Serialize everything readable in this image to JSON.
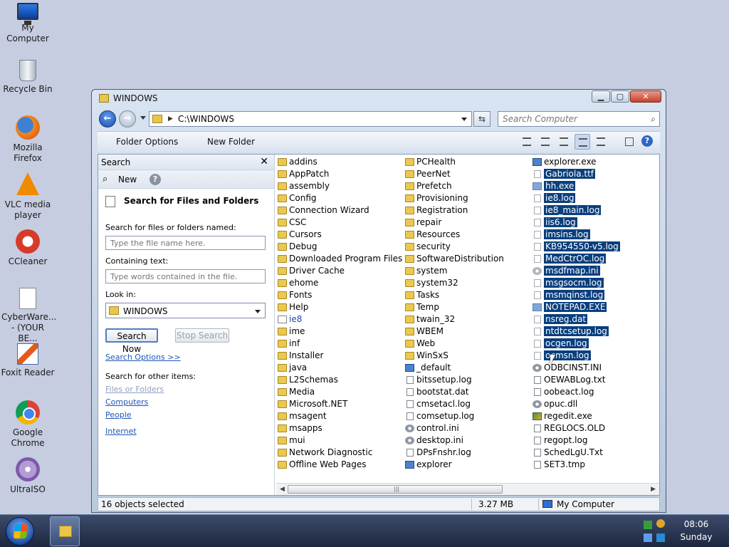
{
  "desktop": {
    "icons": [
      {
        "label": "My Computer",
        "icon": "computer-icon"
      },
      {
        "label": "Recycle Bin",
        "icon": "recycle-bin-icon"
      },
      {
        "label": "Mozilla Firefox",
        "icon": "firefox-icon"
      },
      {
        "label": "VLC media player",
        "icon": "vlc-icon"
      },
      {
        "label": "CCleaner",
        "icon": "ccleaner-icon"
      },
      {
        "label": "CyberWare... - (YOUR BE...",
        "icon": "document-icon"
      },
      {
        "label": "Foxit Reader",
        "icon": "foxit-icon"
      },
      {
        "label": "Google Chrome",
        "icon": "chrome-icon"
      },
      {
        "label": "UltraISO",
        "icon": "ultraiso-icon"
      }
    ]
  },
  "window": {
    "title": "WINDOWS",
    "controls": {
      "minimize": "▁",
      "maximize": "▢",
      "close": "✕"
    },
    "address": {
      "path": "C:\\WINDOWS"
    },
    "search": {
      "placeholder": "Search Computer"
    },
    "toolbar": {
      "folder_options": "Folder Options",
      "new_folder": "New Folder"
    },
    "search_pane": {
      "header": "Search",
      "close": "✕",
      "new_label": "New",
      "help": "?",
      "title": "Search for Files and Folders",
      "named_label": "Search for files or folders named:",
      "named_placeholder": "Type the file name here.",
      "containing_label": "Containing text:",
      "containing_placeholder": "Type words contained in the file.",
      "look_in_label": "Look in:",
      "look_in_value": "WINDOWS",
      "search_now": "Search Now",
      "stop_search": "Stop Search",
      "search_options": "Search Options >>",
      "other_items_label": "Search for other items:",
      "other_items": [
        "Files or Folders",
        "Computers",
        "People"
      ],
      "internet": "Internet"
    },
    "files": {
      "col1": [
        {
          "name": "addins",
          "type": "folder"
        },
        {
          "name": "AppPatch",
          "type": "folder"
        },
        {
          "name": "assembly",
          "type": "folder"
        },
        {
          "name": "Config",
          "type": "folder"
        },
        {
          "name": "Connection Wizard",
          "type": "folder"
        },
        {
          "name": "CSC",
          "type": "folder"
        },
        {
          "name": "Cursors",
          "type": "folder"
        },
        {
          "name": "Debug",
          "type": "folder"
        },
        {
          "name": "Downloaded Program Files",
          "type": "folder"
        },
        {
          "name": "Driver Cache",
          "type": "folder"
        },
        {
          "name": "ehome",
          "type": "folder"
        },
        {
          "name": "Fonts",
          "type": "folder"
        },
        {
          "name": "Help",
          "type": "folder"
        },
        {
          "name": "ie8",
          "type": "ie"
        },
        {
          "name": "ime",
          "type": "folder"
        },
        {
          "name": "inf",
          "type": "folder"
        },
        {
          "name": "Installer",
          "type": "folder"
        },
        {
          "name": "java",
          "type": "folder"
        },
        {
          "name": "L2Schemas",
          "type": "folder"
        },
        {
          "name": "Media",
          "type": "folder"
        },
        {
          "name": "Microsoft.NET",
          "type": "folder"
        },
        {
          "name": "msagent",
          "type": "folder"
        },
        {
          "name": "msapps",
          "type": "folder"
        },
        {
          "name": "mui",
          "type": "folder"
        },
        {
          "name": "Network Diagnostic",
          "type": "folder"
        },
        {
          "name": "Offline Web Pages",
          "type": "folder"
        }
      ],
      "col2": [
        {
          "name": "PCHealth",
          "type": "folder"
        },
        {
          "name": "PeerNet",
          "type": "folder"
        },
        {
          "name": "Prefetch",
          "type": "folder"
        },
        {
          "name": "Provisioning",
          "type": "folder"
        },
        {
          "name": "Registration",
          "type": "folder"
        },
        {
          "name": "repair",
          "type": "folder"
        },
        {
          "name": "Resources",
          "type": "folder"
        },
        {
          "name": "security",
          "type": "folder"
        },
        {
          "name": "SoftwareDistribution",
          "type": "folder"
        },
        {
          "name": "system",
          "type": "folder"
        },
        {
          "name": "system32",
          "type": "folder"
        },
        {
          "name": "Tasks",
          "type": "folder"
        },
        {
          "name": "Temp",
          "type": "folder"
        },
        {
          "name": "twain_32",
          "type": "folder"
        },
        {
          "name": "WBEM",
          "type": "folder"
        },
        {
          "name": "Web",
          "type": "folder"
        },
        {
          "name": "WinSxS",
          "type": "folder"
        },
        {
          "name": "_default",
          "type": "exe"
        },
        {
          "name": "bitssetup.log",
          "type": "file"
        },
        {
          "name": "bootstat.dat",
          "type": "file"
        },
        {
          "name": "cmsetacl.log",
          "type": "file"
        },
        {
          "name": "comsetup.log",
          "type": "file"
        },
        {
          "name": "control.ini",
          "type": "gear"
        },
        {
          "name": "desktop.ini",
          "type": "gear"
        },
        {
          "name": "DPsFnshr.log",
          "type": "file"
        },
        {
          "name": "explorer",
          "type": "exe"
        }
      ],
      "col3": [
        {
          "name": "explorer.exe",
          "type": "exe",
          "selected": false
        },
        {
          "name": "Gabriola.ttf",
          "type": "file",
          "selected": true
        },
        {
          "name": "hh.exe",
          "type": "exe",
          "selected": true
        },
        {
          "name": "ie8.log",
          "type": "file",
          "selected": true
        },
        {
          "name": "ie8_main.log",
          "type": "file",
          "selected": true
        },
        {
          "name": "iis6.log",
          "type": "file",
          "selected": true
        },
        {
          "name": "imsins.log",
          "type": "file",
          "selected": true
        },
        {
          "name": "KB954550-v5.log",
          "type": "file",
          "selected": true
        },
        {
          "name": "MedCtrOC.log",
          "type": "file",
          "selected": true
        },
        {
          "name": "msdfmap.ini",
          "type": "gear",
          "selected": true
        },
        {
          "name": "msgsocm.log",
          "type": "file",
          "selected": true
        },
        {
          "name": "msmqinst.log",
          "type": "file",
          "selected": true
        },
        {
          "name": "NOTEPAD.EXE",
          "type": "exe",
          "selected": true
        },
        {
          "name": "nsreg.dat",
          "type": "file",
          "selected": true
        },
        {
          "name": "ntdtcsetup.log",
          "type": "file",
          "selected": true
        },
        {
          "name": "ocgen.log",
          "type": "file",
          "selected": true
        },
        {
          "name": "ocmsn.log",
          "type": "file",
          "selected": true
        },
        {
          "name": "ODBCINST.INI",
          "type": "gear",
          "selected": false
        },
        {
          "name": "OEWABLog.txt",
          "type": "file",
          "selected": false
        },
        {
          "name": "oobeact.log",
          "type": "file",
          "selected": false
        },
        {
          "name": "opuc.dll",
          "type": "gear",
          "selected": false
        },
        {
          "name": "regedit.exe",
          "type": "reg",
          "selected": false
        },
        {
          "name": "REGLOCS.OLD",
          "type": "file",
          "selected": false
        },
        {
          "name": "regopt.log",
          "type": "file",
          "selected": false
        },
        {
          "name": "SchedLgU.Txt",
          "type": "file",
          "selected": false
        },
        {
          "name": "SET3.tmp",
          "type": "file",
          "selected": false
        }
      ]
    },
    "status": {
      "selected": "16 objects selected",
      "size": "3.27 MB",
      "location": "My Computer"
    }
  },
  "taskbar": {
    "time": "08:06",
    "day": "Sunday"
  }
}
